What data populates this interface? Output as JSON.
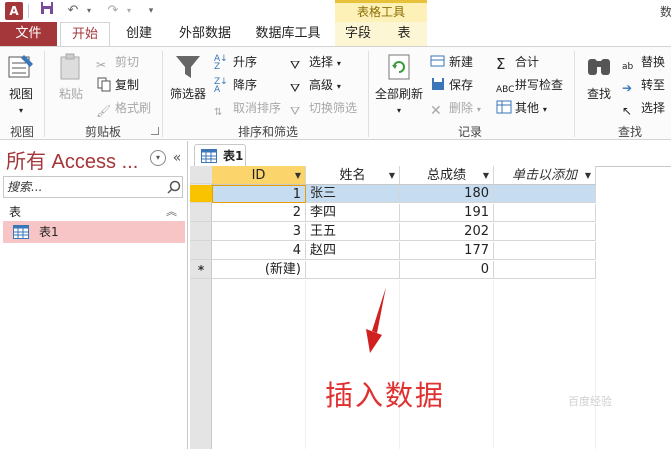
{
  "app": {
    "icon_text": "A",
    "title_right": "数"
  },
  "quick_access": {
    "save_icon": "save-icon",
    "undo_icon": "undo-icon",
    "redo_icon": "redo-icon",
    "customize_icon": "customize-icon"
  },
  "context_tools": "表格工具",
  "tabs": [
    "文件",
    "开始",
    "创建",
    "外部数据",
    "数据库工具",
    "字段",
    "表"
  ],
  "ribbon": {
    "view": {
      "label": "视图",
      "group": "视图"
    },
    "clipboard": {
      "paste": "粘贴",
      "cut": "剪切",
      "copy": "复制",
      "format_painter": "格式刷",
      "group": "剪贴板"
    },
    "sort_filter": {
      "filter": "筛选器",
      "ascending": "升序",
      "descending": "降序",
      "remove_sort": "取消排序",
      "selection": "选择",
      "advanced": "高级",
      "toggle_filter": "切换筛选",
      "group": "排序和筛选"
    },
    "records": {
      "refresh_all": "全部刷新",
      "new": "新建",
      "save": "保存",
      "delete": "删除",
      "totals": "合计",
      "spelling": "拼写检查",
      "more": "其他",
      "group": "记录"
    },
    "find": {
      "find": "查找",
      "replace": "替换",
      "goto": "转至",
      "select": "选择",
      "group": "查找"
    }
  },
  "nav": {
    "title": "所有 Access ...",
    "search_placeholder": "搜索...",
    "section": "表",
    "items": [
      {
        "label": "表1"
      }
    ]
  },
  "document": {
    "tab": "表1",
    "columns": [
      "ID",
      "姓名",
      "总成绩",
      "单击以添加"
    ],
    "rows": [
      {
        "id": "1",
        "name": "张三",
        "score": "180"
      },
      {
        "id": "2",
        "name": "李四",
        "score": "191"
      },
      {
        "id": "3",
        "name": "王五",
        "score": "202"
      },
      {
        "id": "4",
        "name": "赵四",
        "score": "177"
      }
    ],
    "new_row": {
      "marker": "*",
      "id": "(新建)",
      "score": "0"
    }
  },
  "annotation": "插入数据",
  "watermark": "百度经验"
}
